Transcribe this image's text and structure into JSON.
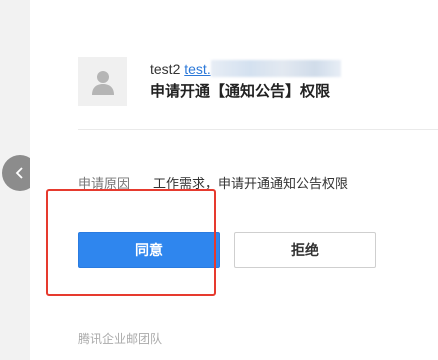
{
  "sender": {
    "name": "test2",
    "email_visible": "test."
  },
  "request": {
    "title": "申请开通【通知公告】权限",
    "reason_label": "申请原因",
    "reason_value": "工作需求，申请开通通知公告权限"
  },
  "actions": {
    "approve_label": "同意",
    "reject_label": "拒绝"
  },
  "footer": {
    "signature": "腾讯企业邮团队"
  },
  "icons": {
    "avatar": "person-icon",
    "nav_prev": "chevron-left-icon"
  },
  "colors": {
    "primary": "#2f86ee",
    "link": "#2b78d8",
    "highlight": "#e63a2e"
  }
}
